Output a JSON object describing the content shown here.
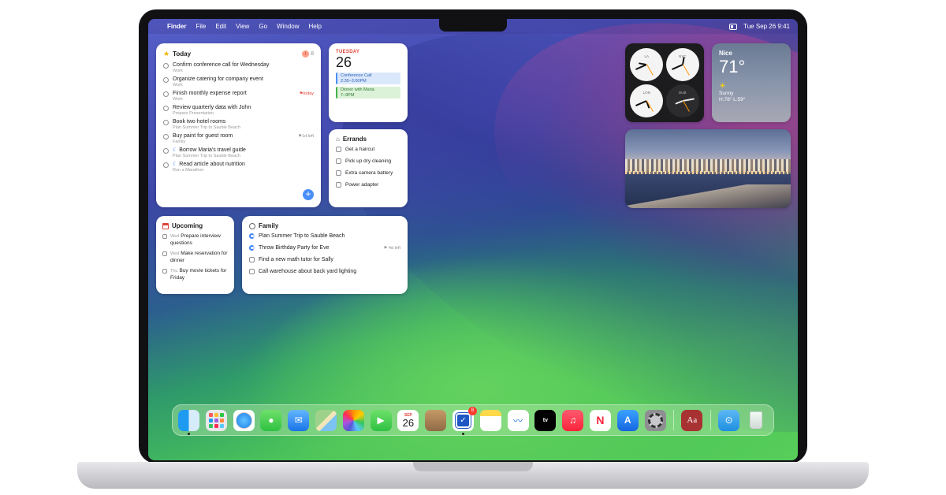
{
  "menubar": {
    "app": "Finder",
    "menus": [
      "File",
      "Edit",
      "View",
      "Go",
      "Window",
      "Help"
    ],
    "clock": "Tue Sep 26  9:41"
  },
  "today": {
    "title": "Today",
    "count": "8",
    "tasks": [
      {
        "title": "Confirm conference call for Wednesday",
        "list": "Work",
        "meta": ""
      },
      {
        "title": "Organize catering for company event",
        "list": "Work",
        "meta": ""
      },
      {
        "title": "Finish monthly expense report",
        "list": "Work",
        "meta": "today"
      },
      {
        "title": "Review quarterly data with John",
        "list": "Prepare Presentation",
        "meta": ""
      },
      {
        "title": "Book two hotel rooms",
        "list": "Plan Summer Trip to Sauble Beach",
        "meta": ""
      },
      {
        "title": "Buy paint for guest room",
        "list": "Family",
        "meta": "1d left"
      },
      {
        "title": "Borrow Maria's travel guide",
        "list": "Plan Summer Trip to Sauble Beach",
        "meta": ""
      },
      {
        "title": "Read article about nutrition",
        "list": "Run a Marathon",
        "meta": ""
      }
    ]
  },
  "calendar": {
    "day": "TUESDAY",
    "date": "26",
    "events": [
      {
        "title": "Conference Call",
        "time": "2:30–3:00PM",
        "color": "#4a8ff7"
      },
      {
        "title": "Dinner with Maria",
        "time": "7–9PM",
        "color": "#44b048"
      }
    ]
  },
  "errands": {
    "title": "Errands",
    "items": [
      "Get a haircut",
      "Pick up dry cleaning",
      "Extra camera battery",
      "Power adapter"
    ]
  },
  "upcoming": {
    "title": "Upcoming",
    "items": [
      {
        "day": "Wed",
        "title": "Prepare interview questions"
      },
      {
        "day": "Wed",
        "title": "Make reservation for dinner"
      },
      {
        "day": "Thu",
        "title": "Buy movie tickets for Friday"
      }
    ]
  },
  "family": {
    "title": "Family",
    "items": [
      {
        "title": "Plan Summer Trip to Sauble Beach",
        "meta": ""
      },
      {
        "title": "Throw Birthday Party for Eve",
        "meta": "4d left"
      },
      {
        "title": "Find a new math tutor for Sally",
        "meta": ""
      },
      {
        "title": "Call warehouse about back yard lighting",
        "meta": ""
      }
    ]
  },
  "clocks": {
    "cities": [
      "LA",
      "NYC",
      "LON",
      "DUB"
    ]
  },
  "weather": {
    "city": "Nice",
    "temp": "71°",
    "condition": "Sunny",
    "high_low": "H:78° L:59°"
  },
  "dock": {
    "calendar_month": "SEP",
    "calendar_day": "26",
    "reminders_badge": "8",
    "tv_label": "tv",
    "news_label": "N",
    "appstore_label": "A",
    "dictionary_label": "Aa",
    "apps": [
      "finder-icon",
      "launchpad-icon",
      "safari-icon",
      "messages-icon",
      "mail-icon",
      "maps-icon",
      "photos-icon",
      "facetime-icon",
      "calendar-icon",
      "contacts-icon",
      "reminders-icon",
      "notes-icon",
      "freeform-icon",
      "tv-icon",
      "music-icon",
      "news-icon",
      "app-store-icon",
      "settings-icon",
      "dictionary-icon",
      "downloads-folder-icon",
      "trash-icon"
    ]
  }
}
